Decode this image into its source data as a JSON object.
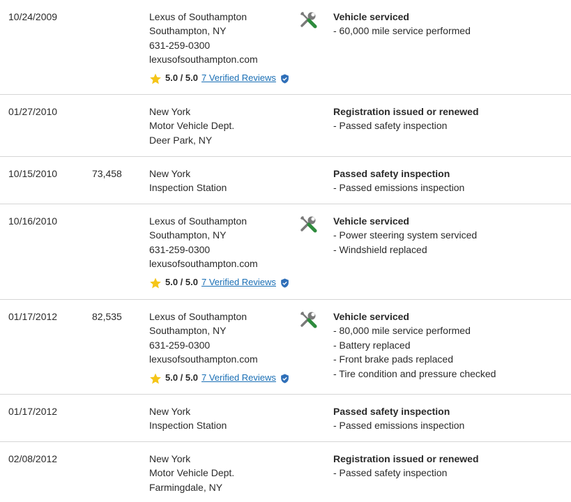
{
  "records": [
    {
      "date": "10/24/2009",
      "mileage": "",
      "source": [
        "Lexus of Southampton",
        "Southampton, NY",
        "631-259-0300",
        "lexusofsouthampton.com"
      ],
      "has_rating": true,
      "rating": {
        "score": "5.0 / 5.0",
        "reviews_label": "7 Verified Reviews"
      },
      "icon": "service-tools-icon",
      "detail_title": "Vehicle serviced",
      "detail_items": [
        "- 60,000 mile service performed"
      ]
    },
    {
      "date": "01/27/2010",
      "mileage": "",
      "source": [
        "New York",
        "Motor Vehicle Dept.",
        "Deer Park, NY"
      ],
      "has_rating": false,
      "icon": "",
      "detail_title": "Registration issued or renewed",
      "detail_items": [
        "- Passed safety inspection"
      ]
    },
    {
      "date": "10/15/2010",
      "mileage": "73,458",
      "source": [
        "New York",
        "Inspection Station"
      ],
      "has_rating": false,
      "icon": "",
      "detail_title": "Passed safety inspection",
      "detail_items": [
        "- Passed emissions inspection"
      ]
    },
    {
      "date": "10/16/2010",
      "mileage": "",
      "source": [
        "Lexus of Southampton",
        "Southampton, NY",
        "631-259-0300",
        "lexusofsouthampton.com"
      ],
      "has_rating": true,
      "rating": {
        "score": "5.0 / 5.0",
        "reviews_label": "7 Verified Reviews"
      },
      "icon": "service-tools-icon",
      "detail_title": "Vehicle serviced",
      "detail_items": [
        "- Power steering system serviced",
        "- Windshield replaced"
      ]
    },
    {
      "date": "01/17/2012",
      "mileage": "82,535",
      "source": [
        "Lexus of Southampton",
        "Southampton, NY",
        "631-259-0300",
        "lexusofsouthampton.com"
      ],
      "has_rating": true,
      "rating": {
        "score": "5.0 / 5.0",
        "reviews_label": "7 Verified Reviews"
      },
      "icon": "service-tools-icon",
      "detail_title": "Vehicle serviced",
      "detail_items": [
        "- 80,000 mile service performed",
        "- Battery replaced",
        "- Front brake pads replaced",
        "- Tire condition and pressure checked"
      ]
    },
    {
      "date": "01/17/2012",
      "mileage": "",
      "source": [
        "New York",
        "Inspection Station"
      ],
      "has_rating": false,
      "icon": "",
      "detail_title": "Passed safety inspection",
      "detail_items": [
        "- Passed emissions inspection"
      ]
    },
    {
      "date": "02/08/2012",
      "mileage": "",
      "source": [
        "New York",
        "Motor Vehicle Dept.",
        "Farmingdale, NY"
      ],
      "has_rating": false,
      "icon": "",
      "detail_title": "Registration issued or renewed",
      "detail_items": [
        "- Passed safety inspection"
      ]
    }
  ],
  "colors": {
    "star": "#f5c518",
    "link": "#1a6fb5",
    "shield": "#2f6fb8",
    "wrench": "#7a7a7a",
    "screwdriver_handle": "#2e8b3d",
    "divider": "#d6d6d6"
  }
}
